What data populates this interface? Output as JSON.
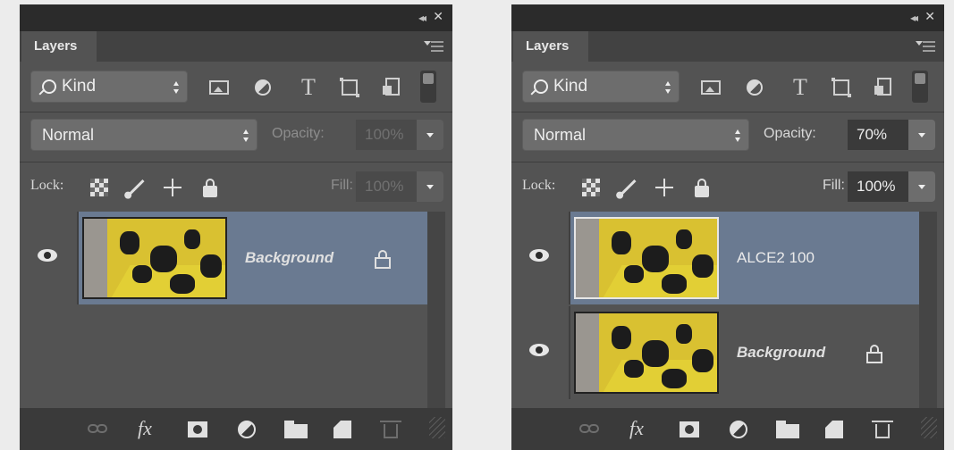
{
  "panels": [
    {
      "tab_label": "Layers",
      "kind_label": "Kind",
      "blend_mode": "Normal",
      "opacity_label": "Opacity:",
      "opacity_value": "100%",
      "lock_label": "Lock:",
      "fill_label": "Fill:",
      "fill_value": "100%",
      "controls_enabled": false,
      "layers": [
        {
          "name": "Background",
          "visible": true,
          "selected": true,
          "locked": true
        }
      ]
    },
    {
      "tab_label": "Layers",
      "kind_label": "Kind",
      "blend_mode": "Normal",
      "opacity_label": "Opacity:",
      "opacity_value": "70%",
      "lock_label": "Lock:",
      "fill_label": "Fill:",
      "fill_value": "100%",
      "controls_enabled": true,
      "layers": [
        {
          "name": "ALCE2 100",
          "visible": true,
          "selected": true,
          "locked": false
        },
        {
          "name": "Background",
          "visible": true,
          "selected": false,
          "locked": true
        }
      ]
    }
  ],
  "icons": {
    "collapse": "collapse-icon",
    "close": "close-icon",
    "panel_menu": "panel-menu-icon",
    "filters": [
      "pixel-filter-icon",
      "adjustment-filter-icon",
      "type-filter-icon",
      "shape-filter-icon",
      "smart-object-filter-icon"
    ],
    "locks": [
      "lock-transparent-icon",
      "lock-paint-icon",
      "lock-position-icon",
      "lock-all-icon"
    ],
    "bottom": [
      "link-layers-icon",
      "fx-icon",
      "add-mask-icon",
      "adjustment-layer-icon",
      "new-group-icon",
      "new-layer-icon",
      "trash-icon"
    ]
  },
  "colors": {
    "panel_bg": "#535353",
    "selected_row": "#6a7a91",
    "thumbnail_yellow": "#d9c131"
  }
}
